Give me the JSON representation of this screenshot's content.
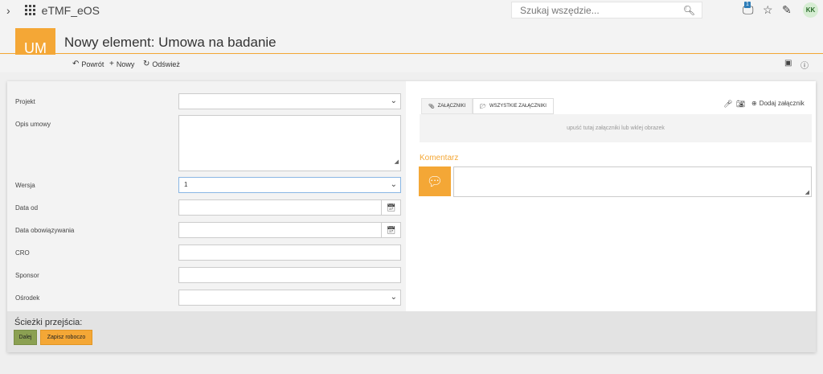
{
  "app": {
    "name": "eTMF_eOS"
  },
  "search": {
    "placeholder": "Szukaj wszędzie..."
  },
  "topbar": {
    "notification_count": "1",
    "avatar_initials": "KK"
  },
  "header": {
    "initials": "UM",
    "title": "Nowy element: Umowa na badanie"
  },
  "commands": {
    "back": "Powrót",
    "new": "Nowy",
    "refresh": "Odśwież"
  },
  "form": {
    "fields": [
      {
        "label": "Projekt",
        "value": ""
      },
      {
        "label": "Opis umowy",
        "value": ""
      },
      {
        "label": "Wersja",
        "value": "1"
      },
      {
        "label": "Data od",
        "value": ""
      },
      {
        "label": "Data obowiązywania",
        "value": ""
      },
      {
        "label": "CRO",
        "value": ""
      },
      {
        "label": "Sponsor",
        "value": ""
      },
      {
        "label": "Ośrodek",
        "value": ""
      }
    ]
  },
  "attachments": {
    "tab_attachments": "ZAŁĄCZNIKI",
    "tab_all": "WSZYSTKIE ZAŁĄCZNIKI",
    "add_label": "Dodaj załącznik",
    "dropzone_text": "upuść tutaj załączniki lub wklej obrazek"
  },
  "comment": {
    "label": "Komentarz"
  },
  "transitions": {
    "label": "Ścieżki przejścia:",
    "next": "Dalej",
    "save_draft": "Zapisz roboczo"
  },
  "colors": {
    "accent": "#f4a736",
    "next_button": "#8ba052",
    "badge": "#2e7db8"
  }
}
